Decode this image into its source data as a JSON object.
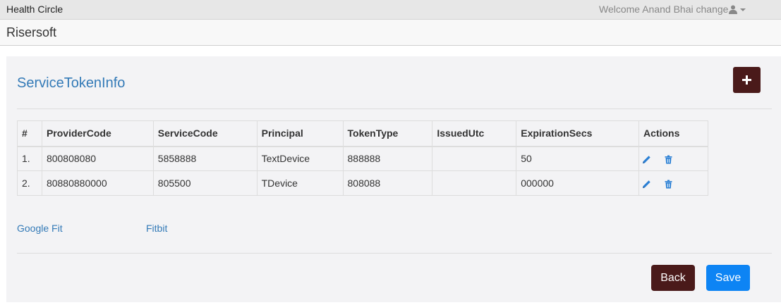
{
  "topbar": {
    "app_title": "Health Circle",
    "welcome_text": "Welcome Anand Bhai change",
    "user_icon": "user-icon",
    "dropdown_icon": "caret-down-icon"
  },
  "brandbar": {
    "brand": "Risersoft"
  },
  "page": {
    "title": "ServiceTokenInfo",
    "add_icon": "plus-icon"
  },
  "table": {
    "headers": {
      "index": "#",
      "provider_code": "ProviderCode",
      "service_code": "ServiceCode",
      "principal": "Principal",
      "token_type": "TokenType",
      "issued_utc": "IssuedUtc",
      "expiration_secs": "ExpirationSecs",
      "actions": "Actions"
    },
    "rows": [
      {
        "index": "1.",
        "provider_code": "800808080",
        "service_code": "5858888",
        "principal": "TextDevice",
        "token_type": "888888",
        "issued_utc": "",
        "expiration_secs": "50"
      },
      {
        "index": "2.",
        "provider_code": "80880880000",
        "service_code": "805500",
        "principal": "TDevice",
        "token_type": "808088",
        "issued_utc": "",
        "expiration_secs": "000000"
      }
    ],
    "action_icons": [
      "pencil-icon",
      "trash-icon"
    ]
  },
  "links": {
    "google_fit": "Google Fit",
    "fitbit": "Fitbit"
  },
  "buttons": {
    "back": "Back",
    "save": "Save"
  },
  "colors": {
    "accent_dark": "#4a1a1a",
    "primary_blue": "#0d84f4",
    "link_blue": "#337ab7"
  }
}
